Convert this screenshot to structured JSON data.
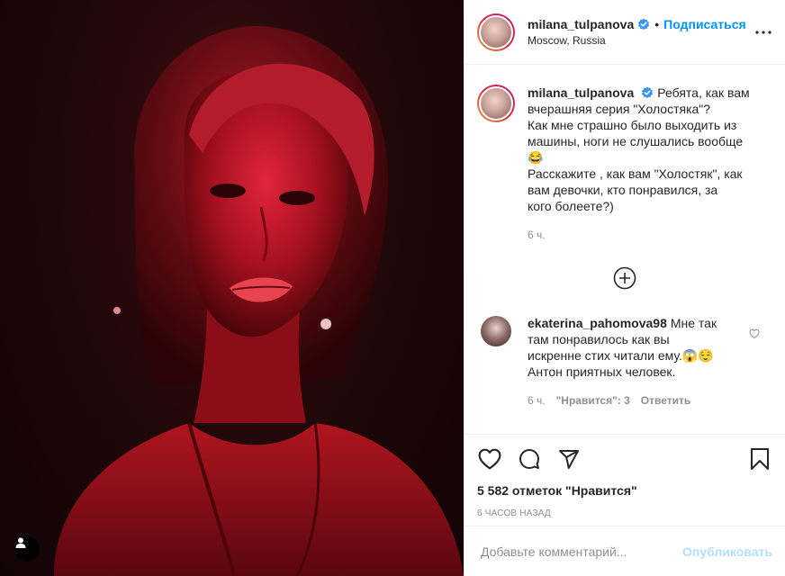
{
  "post": {
    "username": "milana_tulpanova",
    "follow_label": "Подписаться",
    "location": "Moscow, Russia",
    "caption_lines": [
      "Ребята, как вам",
      "вчерашняя серия \"Холостяка\"?",
      "Как мне страшно было выходить из",
      "машины, ноги не слушались вообще",
      "😂",
      "Расскажите , как вам \"Холостяк\", как",
      "вам девочки, кто понравился, за",
      "кого болеете?)"
    ],
    "caption_time": "6 ч."
  },
  "comment": {
    "username": "ekaterina_pahomova98",
    "text_lines": [
      "Мне так",
      "там понравилось как вы",
      "искренне стих читали ему.😱😌",
      "Антон приятных человек."
    ],
    "time": "6 ч.",
    "likes": "\"Нравится\": 3",
    "reply": "Ответить"
  },
  "footer": {
    "likes_count": "5 582 отметок \"Нравится\"",
    "time_ago": "6 часов назад",
    "comment_placeholder": "Добавьте комментарий...",
    "publish_label": "Опубликовать"
  },
  "colors": {
    "accent": "#0095f6",
    "publish_disabled": "#b2dffc",
    "muted": "#8e8e8e",
    "text": "#262626"
  },
  "icons": [
    "more-options-icon",
    "verified-badge-icon",
    "load-more-plus-icon",
    "heart-icon",
    "comment-icon",
    "share-icon",
    "bookmark-icon",
    "tagged-user-icon"
  ]
}
